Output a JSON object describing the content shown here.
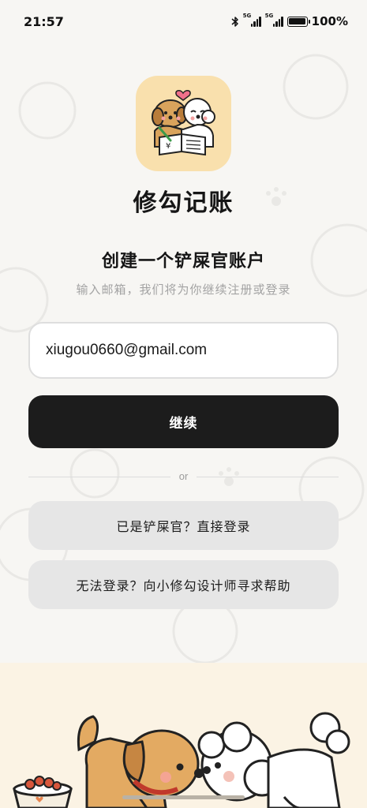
{
  "status_bar": {
    "time": "21:57",
    "network_1": "5G",
    "network_2": "5G",
    "battery_text": "100%",
    "battery_level": 1.0
  },
  "app": {
    "name": "修勾记账",
    "icon": "dog-bookkeeping-logo-icon"
  },
  "signup": {
    "heading": "创建一个铲屎官账户",
    "subheading": "输入邮箱，我们将为你继续注册或登录",
    "email_value": "xiugou0660@gmail.com",
    "continue_label": "继续",
    "divider_text": "or",
    "login_label": "已是铲屎官？直接登录",
    "help_label": "无法登录？向小修勾设计师寻求帮助"
  },
  "colors": {
    "background": "#f7f6f3",
    "primary_button": "#1c1c1c",
    "secondary_button": "#e6e6e6",
    "logo_background": "#f9e0ad",
    "muted_text": "#a3a3a3"
  },
  "illustration": {
    "icon": "two-dogs-with-food-bowl-illustration"
  }
}
